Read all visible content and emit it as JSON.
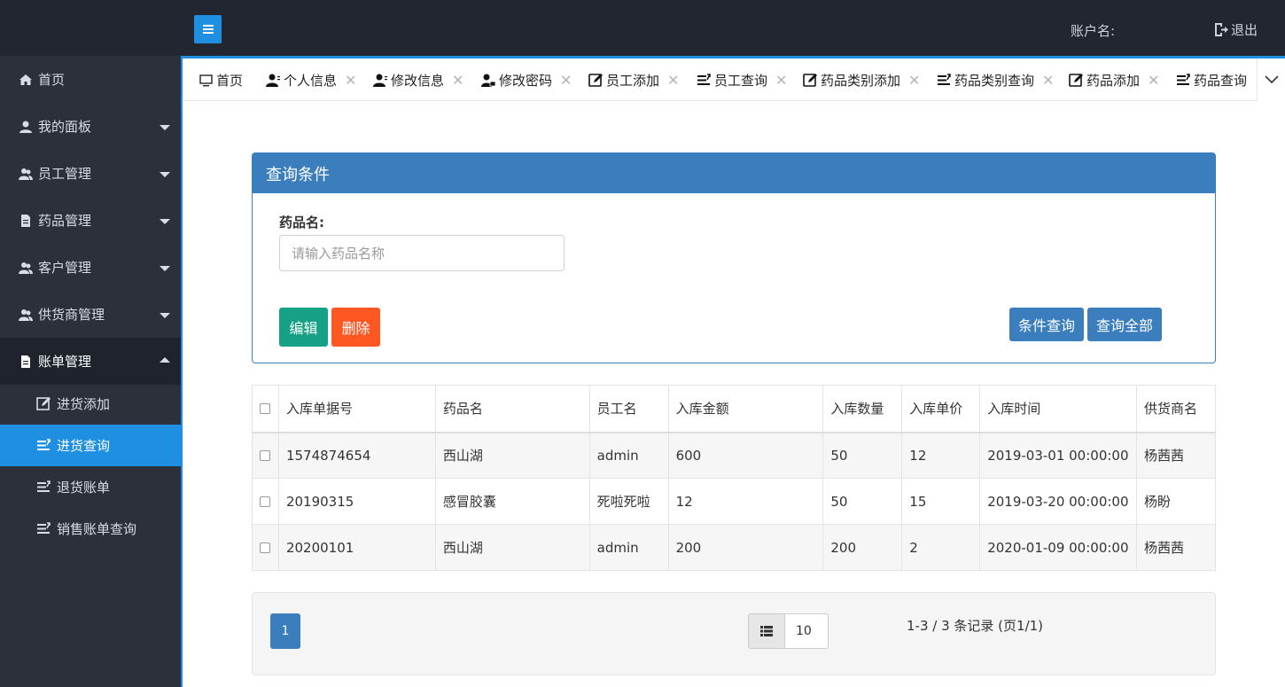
{
  "header": {
    "account_label": "账户名:",
    "logout_label": "退出"
  },
  "sidebar": {
    "items": [
      {
        "label": "首页",
        "icon": "home-icon"
      },
      {
        "label": "我的面板",
        "icon": "user-icon"
      },
      {
        "label": "员工管理",
        "icon": "users-icon"
      },
      {
        "label": "药品管理",
        "icon": "file-icon"
      },
      {
        "label": "客户管理",
        "icon": "users-icon"
      },
      {
        "label": "供货商管理",
        "icon": "users-icon"
      },
      {
        "label": "账单管理",
        "icon": "file-icon",
        "expanded": true
      }
    ],
    "subitems": [
      {
        "label": "进货添加",
        "icon": "edit-icon"
      },
      {
        "label": "进货查询",
        "icon": "list-icon",
        "active": true
      },
      {
        "label": "退货账单",
        "icon": "list-icon"
      },
      {
        "label": "销售账单查询",
        "icon": "list-icon"
      }
    ]
  },
  "tabs": [
    {
      "label": "首页",
      "icon": "monitor-icon"
    },
    {
      "label": "个人信息",
      "icon": "user-card-icon"
    },
    {
      "label": "修改信息",
      "icon": "user-card-icon"
    },
    {
      "label": "修改密码",
      "icon": "user-lock-icon"
    },
    {
      "label": "员工添加",
      "icon": "edit-icon"
    },
    {
      "label": "员工查询",
      "icon": "list-icon"
    },
    {
      "label": "药品类别添加",
      "icon": "edit-icon"
    },
    {
      "label": "药品类别查询",
      "icon": "list-icon"
    },
    {
      "label": "药品添加",
      "icon": "edit-icon"
    },
    {
      "label": "药品查询",
      "icon": "list-icon"
    }
  ],
  "query": {
    "title": "查询条件",
    "field_label": "药品名:",
    "placeholder": "请输入药品名称",
    "edit_label": "编辑",
    "delete_label": "删除",
    "cond_search_label": "条件查询",
    "search_all_label": "查询全部"
  },
  "table": {
    "columns": [
      "入库单据号",
      "药品名",
      "员工名",
      "入库金额",
      "入库数量",
      "入库单价",
      "入库时间",
      "供货商名"
    ],
    "rows": [
      [
        "1574874654",
        "西山湖",
        "admin",
        "600",
        "50",
        "12",
        "2019-03-01 00:00:00",
        "杨茜茜"
      ],
      [
        "20190315",
        "感冒胶囊",
        "死啦死啦",
        "12",
        "50",
        "15",
        "2019-03-20 00:00:00",
        "杨盼"
      ],
      [
        "20200101",
        "西山湖",
        "admin",
        "200",
        "200",
        "2",
        "2020-01-09 00:00:00",
        "杨茜茜"
      ]
    ]
  },
  "pager": {
    "current_page": "1",
    "page_size": "10",
    "info": "1-3 / 3 条记录 (页1/1)"
  },
  "colors": {
    "accent": "#1e8fe1",
    "panel": "#3a7ebd",
    "edit": "#16a085",
    "delete": "#ff5722",
    "sidebar": "#2b303b",
    "topbar": "#212631"
  }
}
